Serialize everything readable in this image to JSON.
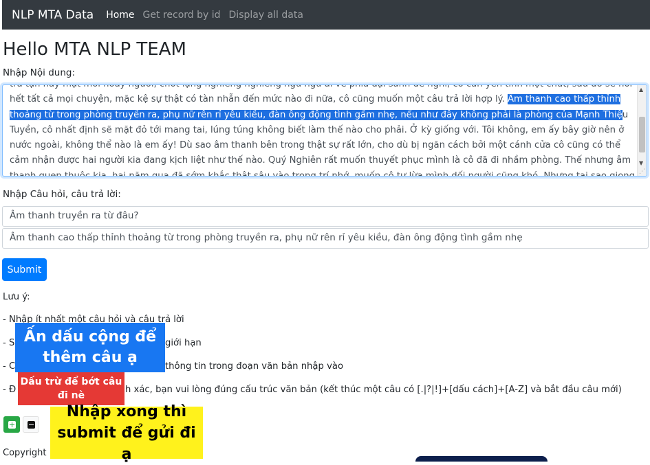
{
  "navbar": {
    "brand": "NLP MTA Data",
    "links": [
      "Home",
      "Get record by id",
      "Display all data"
    ]
  },
  "page_title": "Hello MTA NLP TEAM",
  "content_label": "Nhập Nội dung:",
  "content_text": {
    "top_partial": "trả tận này mặt mới hoảy người, chờt lặng nghiêng nghiêng ngủ ngủ ấi về phía đại sảnh để nghỉ, cô cần yên tĩnh một chút, sau đó sẽ nói hết tất cả",
    "line2_before": "mọi chuyện, mặc kệ sự thật có tàn nhẫn đến mức nào đi nữa, cô cũng muốn một câu trả lời hợp lý. ",
    "selected": "Âm thanh cao thấp thỉnh thoảng từ trong phòng truyền ra, phụ nữ rên rỉ yêu kiều, đàn ông động tình gầm nhẹ, nếu như đây không phải là phòng của Mạnh Thiệ",
    "after_selected": "u Tuyền, cô nhất định sẽ mặt đỏ tới mang tai, lúng túng không biết làm thế nào cho phải. Ở kỳ giống với. Tôi không, em ấy bây giờ nên ở nước ngoài, không thể nào là em ấy! Dù sao âm thanh bên trong thật sự rất lớn, cho dù bị ngăn cách bởi một cánh cửa cô cũng có thể cảm nhận được hai người kia đang kịch liệt như thế nào. Quý Nghiên rất muốn thuyết phục mình là cô đã đi nhầm phòng. Thế nhưng âm thanh quen thuộc kia, hai năm qua đã sớm khắc thật sâu vào trong trí nhớ, muốn cô tự lừa mình dối người cũng khó. Nhưng tại sao giọng nữ đó lại nghe quen tai như vậy?"
  },
  "qa_label": "Nhập Câu hỏi, câu trả lời:",
  "question_value": "Âm thanh truyền ra từ đâu?",
  "answer_value": "Âm thanh cao thấp thỉnh thoảng từ trong phòng truyền ra, phụ nữ rên rỉ yêu kiều, đàn ông động tình gầm nhẹ",
  "submit_label": "Submit",
  "notes": {
    "heading": "Lưu ý:",
    "n1": "- Nhập ít nhất một câu hỏi và câu trả lời",
    "n2_start": "- Số",
    "n2_end": "giới hạn",
    "n3_start": "- C",
    "n3_end": "thông tin trong đoạn văn bản nhập vào",
    "n4_start": "- Đ",
    "n4_end": "h xác, bạn vui lòng đúng cấu trúc văn bản (kết thúc một câu có [.|?|!]+[dấu cách]+[A-Z] và bắt đầu câu mới)"
  },
  "copyright": "Copyright ©",
  "overlays": {
    "blue": "Ấn dấu cộng để thêm câu ạ",
    "red": "Dấu trừ để bớt câu đi nè",
    "yellow": "Nhập xong thì submit để gửi đi ạ"
  },
  "icons": {
    "add": "plus-icon",
    "remove": "minus-icon"
  },
  "colors": {
    "navbar": "#343a40",
    "primary": "#007bff",
    "success": "#28a745",
    "selection": "#1e6fe0"
  }
}
